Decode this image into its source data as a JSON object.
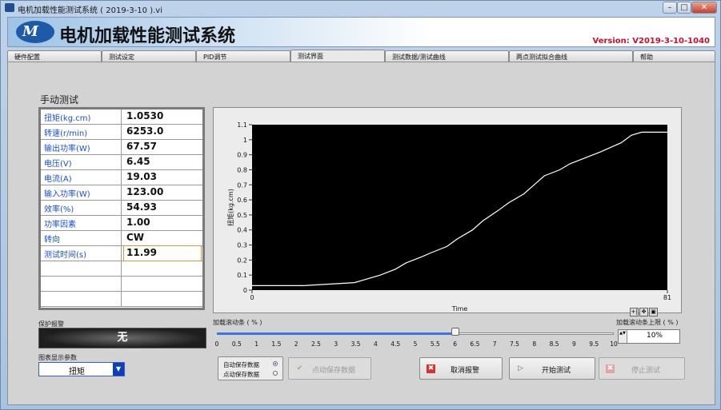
{
  "window": {
    "title": "电机加载性能测试系统 ( 2019-3-10 )",
    "title_suffix": ".vi",
    "min_glyph": "–",
    "max_glyph": "□",
    "close_glyph": "✕"
  },
  "banner": {
    "logo_letter": "M",
    "title": "电机加载性能测试系统",
    "version": "Version: V2019-3-10-1040"
  },
  "tabs": [
    {
      "label": "硬件配置",
      "active": false
    },
    {
      "label": "测试设定",
      "active": false
    },
    {
      "label": "PID调节",
      "active": false
    },
    {
      "label": "测试界面",
      "active": true
    },
    {
      "label": "测试数据/测试曲线",
      "active": false
    },
    {
      "label": "两点测试拟合曲线",
      "active": false
    },
    {
      "label": "帮助",
      "active": false
    }
  ],
  "manual": {
    "section_title": "手动测试",
    "rows": [
      {
        "label": "扭矩(kg.cm)",
        "value": "1.0530"
      },
      {
        "label": "转速(r/min)",
        "value": "6253.0"
      },
      {
        "label": "输出功率(W)",
        "value": "67.57"
      },
      {
        "label": "电压(V)",
        "value": "6.45"
      },
      {
        "label": "电流(A)",
        "value": "19.03"
      },
      {
        "label": "输入功率(W)",
        "value": "123.00"
      },
      {
        "label": "效率(%)",
        "value": "54.93"
      },
      {
        "label": "功率因素",
        "value": "1.00"
      },
      {
        "label": "转向",
        "value": "CW"
      },
      {
        "label": "测试时间(s)",
        "value": "11.99"
      },
      {
        "label": "",
        "value": ""
      },
      {
        "label": "",
        "value": ""
      },
      {
        "label": "",
        "value": ""
      }
    ]
  },
  "chart_data": {
    "type": "line",
    "xlabel": "Time",
    "ylabel": "扭矩(kg.cm)",
    "xlim": [
      0,
      81
    ],
    "ylim": [
      0,
      1.1
    ],
    "x_ticks": [
      "0",
      "81"
    ],
    "y_ticks": [
      "0",
      "0.1",
      "0.2",
      "0.3",
      "0.4",
      "0.5",
      "0.6",
      "0.7",
      "0.8",
      "0.9",
      "1",
      "1.1"
    ],
    "grid": false,
    "line_color": "#ffffff",
    "background": "#000000",
    "series": [
      {
        "x": [
          0,
          5,
          10,
          15,
          20,
          22,
          25,
          28,
          30,
          33,
          35,
          38,
          40,
          43,
          45,
          48,
          50,
          53,
          55,
          57,
          60,
          62,
          65,
          68,
          70,
          72,
          74,
          76,
          77,
          78,
          81
        ],
        "values": [
          0.03,
          0.03,
          0.03,
          0.04,
          0.05,
          0.07,
          0.1,
          0.14,
          0.18,
          0.22,
          0.25,
          0.29,
          0.34,
          0.4,
          0.46,
          0.53,
          0.58,
          0.64,
          0.7,
          0.76,
          0.8,
          0.84,
          0.88,
          0.92,
          0.95,
          0.98,
          1.03,
          1.05,
          1.05,
          1.05,
          1.05
        ]
      }
    ]
  },
  "chart_tools": [
    "+|",
    "✥",
    "▣"
  ],
  "alarm": {
    "label": "保护报警",
    "value": "无"
  },
  "slider": {
    "label": "加载滚动条 ( % )",
    "value": 6,
    "min": 0,
    "max": 10,
    "ticks": [
      "0",
      "0.5",
      "1",
      "1.5",
      "2",
      "2.5",
      "3",
      "3.5",
      "4",
      "4.5",
      "5",
      "5.5",
      "6",
      "6.5",
      "7",
      "7.5",
      "8",
      "8.5",
      "9",
      "9.5",
      "10"
    ]
  },
  "upper_limit": {
    "label": "加载滚动条上限 ( % )",
    "value": "10%",
    "spin_glyph": "▲▼"
  },
  "chart_param": {
    "label": "图表显示参数",
    "selected": "扭矩",
    "arrow_glyph": "▼"
  },
  "save_mode": {
    "options": [
      {
        "label": "自动保存数据",
        "selected": true
      },
      {
        "label": "点动保存数据",
        "selected": false
      }
    ]
  },
  "buttons": {
    "manual_save": {
      "label": "点动保存数据",
      "icon": "✔"
    },
    "cancel_alarm": {
      "label": "取消报警",
      "icon": "✖"
    },
    "start_test": {
      "label": "开始测试",
      "icon": "▷"
    },
    "stop_test": {
      "label": "停止测试",
      "icon": "✖"
    }
  }
}
